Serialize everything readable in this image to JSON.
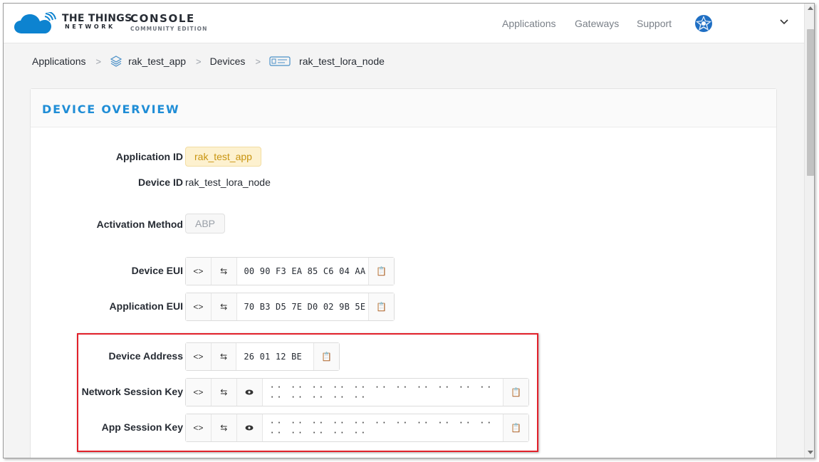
{
  "header": {
    "brand_line1": "THE THINGS",
    "brand_line2": "NETWORK",
    "console_line1": "CONSOLE",
    "console_line2": "COMMUNITY EDITION",
    "nav": [
      "Applications",
      "Gateways",
      "Support"
    ],
    "brand_color": "#1f8dd6"
  },
  "breadcrumb": {
    "items": [
      "Applications",
      "rak_test_app",
      "Devices",
      "rak_test_lora_node"
    ],
    "separator": ">",
    "icons": [
      "layers-icon",
      "device-icon"
    ]
  },
  "overview": {
    "title": "DEVICE OVERVIEW",
    "application_id_label": "Application ID",
    "application_id": "rak_test_app",
    "device_id_label": "Device ID",
    "device_id": "rak_test_lora_node",
    "activation_label": "Activation Method",
    "activation": "ABP",
    "device_eui_label": "Device EUI",
    "device_eui": "00 90 F3 EA 85 C6 04 AA",
    "app_eui_label": "Application EUI",
    "app_eui": "70 B3 D5 7E D0 02 9B 5E",
    "dev_addr_label": "Device Address",
    "dev_addr": "26 01 12 BE",
    "nwk_skey_label": "Network Session Key",
    "nwk_skey": "·· ·· ·· ·· ·· ·· ·· ·· ·· ·· ·· ·· ·· ·· ·· ··",
    "app_skey_label": "App Session Key",
    "app_skey": "·· ·· ·· ·· ·· ·· ·· ·· ·· ·· ·· ·· ·· ·· ·· ··",
    "highlight_color": "#e2202a"
  }
}
